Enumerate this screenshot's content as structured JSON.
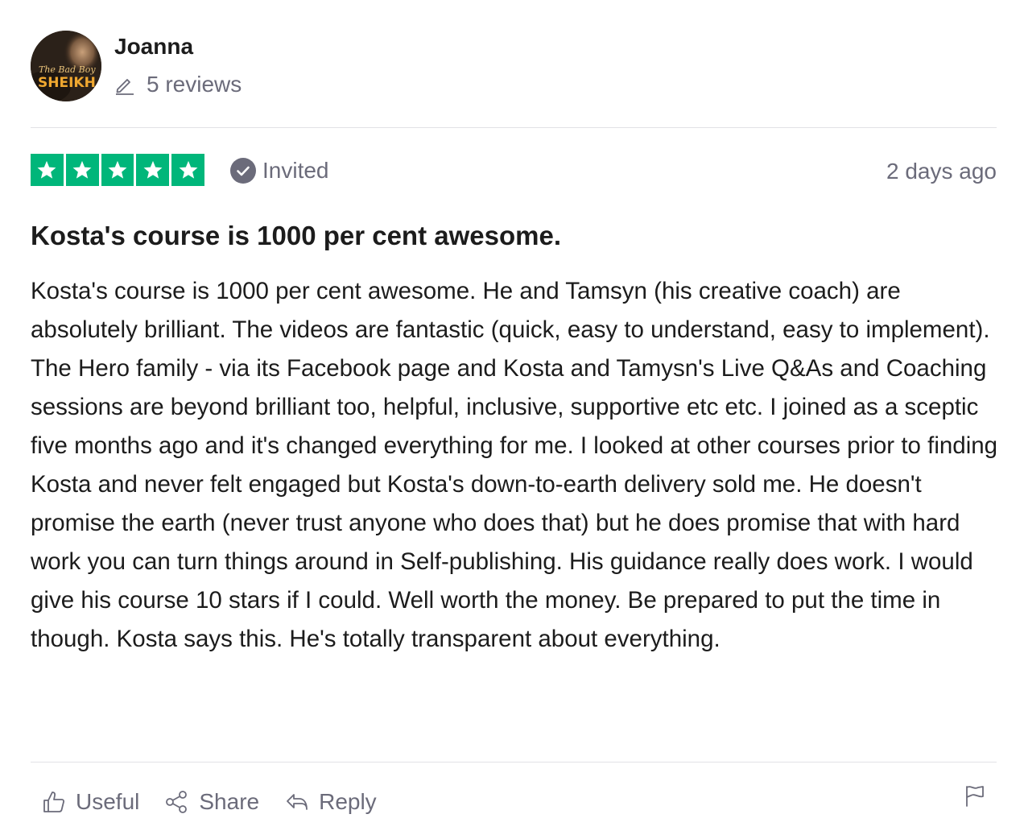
{
  "reviewer": {
    "name": "Joanna",
    "reviews_count": "5 reviews",
    "avatar_text": [
      "The Bad Boy",
      "SHEIKH"
    ]
  },
  "rating": {
    "stars": 5,
    "max_stars": 5,
    "star_color": "#00b67a",
    "invited_label": "Invited",
    "date": "2 days ago"
  },
  "review": {
    "title": "Kosta's course is 1000 per cent awesome.",
    "body": "Kosta's course is 1000 per cent awesome. He and Tamsyn (his creative coach) are absolutely brilliant. The videos are fantastic (quick, easy to understand, easy to implement). The Hero family - via its Facebook page and Kosta and Tamysn's Live Q&As and Coaching sessions are beyond brilliant too, helpful, inclusive, supportive etc etc. I joined as a sceptic five months ago and it's changed everything for me. I looked at other courses prior to finding Kosta and never felt engaged but Kosta's down-to-earth delivery sold me. He doesn't promise the earth (never trust anyone who does that) but he does promise that with hard work you can turn things around in Self-publishing. His guidance really does work. I would give his course 10 stars if I could. Well worth the money. Be prepared to put the time in though. Kosta says this. He's totally transparent about everything."
  },
  "actions": {
    "useful": "Useful",
    "share": "Share",
    "reply": "Reply"
  },
  "icons": {
    "pen": "pencil-icon",
    "check": "check-circle-icon",
    "star": "star-icon",
    "useful": "thumbs-up-icon",
    "share": "share-icon",
    "reply": "reply-icon",
    "flag": "flag-icon"
  }
}
